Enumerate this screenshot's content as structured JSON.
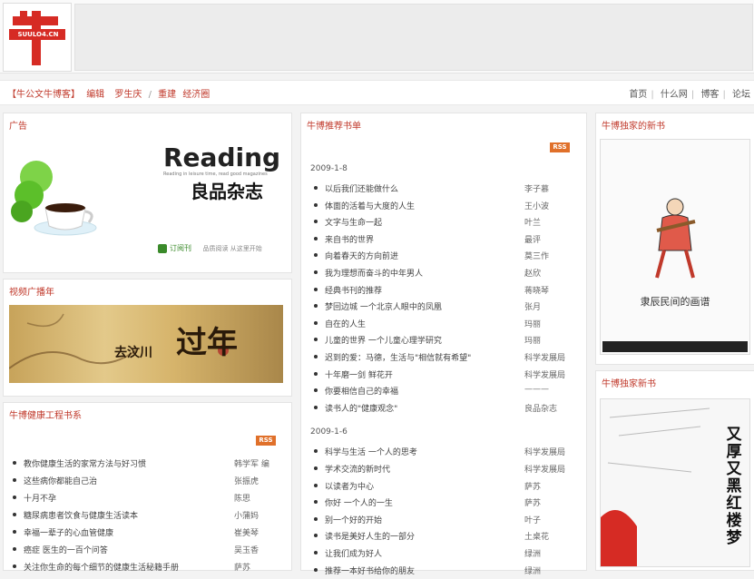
{
  "logo": {
    "text": "SUULO4.CN"
  },
  "breadcrumb": [
    "【牛公文牛博客】",
    "编辑",
    "罗生庆",
    "/",
    "重建",
    "经济圈"
  ],
  "topnav": [
    "首页",
    "什么网",
    "博客",
    "论坛"
  ],
  "ad_panel": {
    "title": "广告",
    "reading": "Reading",
    "reading_cn": "良品杂志",
    "reading_small": "Reading in leisure time, read good magazines",
    "footer": "订阅刊",
    "footer_small": "品质阅读 从这里开始"
  },
  "video_panel": {
    "title": "视频广播年",
    "banner_main": "过年",
    "banner_sub": "去汶川"
  },
  "reading_list_panel": {
    "title": "牛博健康工程书系",
    "rss": "RSS",
    "items": [
      {
        "title": "教你健康生活的家常方法与好习惯",
        "author": "韩学军 编"
      },
      {
        "title": "这些病你都能自己治",
        "author": "张振虎"
      },
      {
        "title": "十月不孕",
        "author": "陈思"
      },
      {
        "title": "糖尿病患者饮食与健康生活读本",
        "author": "小蒲妈"
      },
      {
        "title": "幸福一辈子的心血管健康",
        "author": "崔美琴"
      },
      {
        "title": "癌症 医生的一百个问答",
        "author": "吴玉香"
      },
      {
        "title": "关注你生命的每个细节的健康生活秘籍手册",
        "author": "萨苏"
      }
    ]
  },
  "middle_panel": {
    "title": "牛博推荐书单",
    "rss": "RSS",
    "groups": [
      {
        "date": "2009-1-8",
        "items": [
          {
            "title": "以后我们还能做什么",
            "author": "李子慕"
          },
          {
            "title": "体面的活着与大度的人生",
            "author": "王小波"
          },
          {
            "title": "文字与生命一起",
            "author": "叶兰"
          },
          {
            "title": "来自书的世界",
            "author": "最评"
          },
          {
            "title": "向着春天的方向前进",
            "author": "莫三作"
          },
          {
            "title": "我为理想而奋斗的中年男人",
            "author": "赵欣"
          },
          {
            "title": "经典书刊的推荐",
            "author": "蒋晓琴"
          },
          {
            "title": "梦回边城 一个北京人眼中的凤凰",
            "author": "张月"
          },
          {
            "title": "自在的人生",
            "author": "玛丽"
          },
          {
            "title": "儿童的世界 一个儿童心理学研究",
            "author": "玛丽"
          },
          {
            "title": "迟到的爱：马德，生活与\"相信就有希望\"",
            "author": "科学发展局"
          },
          {
            "title": "十年磨一剑 鲜花开",
            "author": "科学发展局"
          },
          {
            "title": "你要相信自己的幸福",
            "author": "———"
          },
          {
            "title": "读书人的\"健康观念\"",
            "author": "良品杂志"
          }
        ]
      },
      {
        "date": "2009-1-6",
        "items": [
          {
            "title": "科学与生活 一个人的思考",
            "author": "科学发展局"
          },
          {
            "title": "学术交流的新时代",
            "author": "科学发展局"
          },
          {
            "title": "以读者为中心",
            "author": "萨苏"
          },
          {
            "title": "你好 一个人的一生",
            "author": "萨苏"
          },
          {
            "title": "别一个好的开始",
            "author": "叶子"
          },
          {
            "title": "读书是美好人生的一部分",
            "author": "土桌花"
          },
          {
            "title": "让我们成为好人",
            "author": "绿洲"
          },
          {
            "title": "推荐一本好书给你的朋友",
            "author": "绿洲"
          }
        ]
      }
    ]
  },
  "right_panel_1": {
    "title": "牛博独家的新书",
    "book_title": "隶辰民间的画谱"
  },
  "right_panel_2": {
    "title": "牛博独家新书",
    "book_title": "又厚又黑红楼梦"
  },
  "colors": {
    "accent": "#c0392b",
    "rss": "#e0702a",
    "logo_red": "#d62b24"
  }
}
